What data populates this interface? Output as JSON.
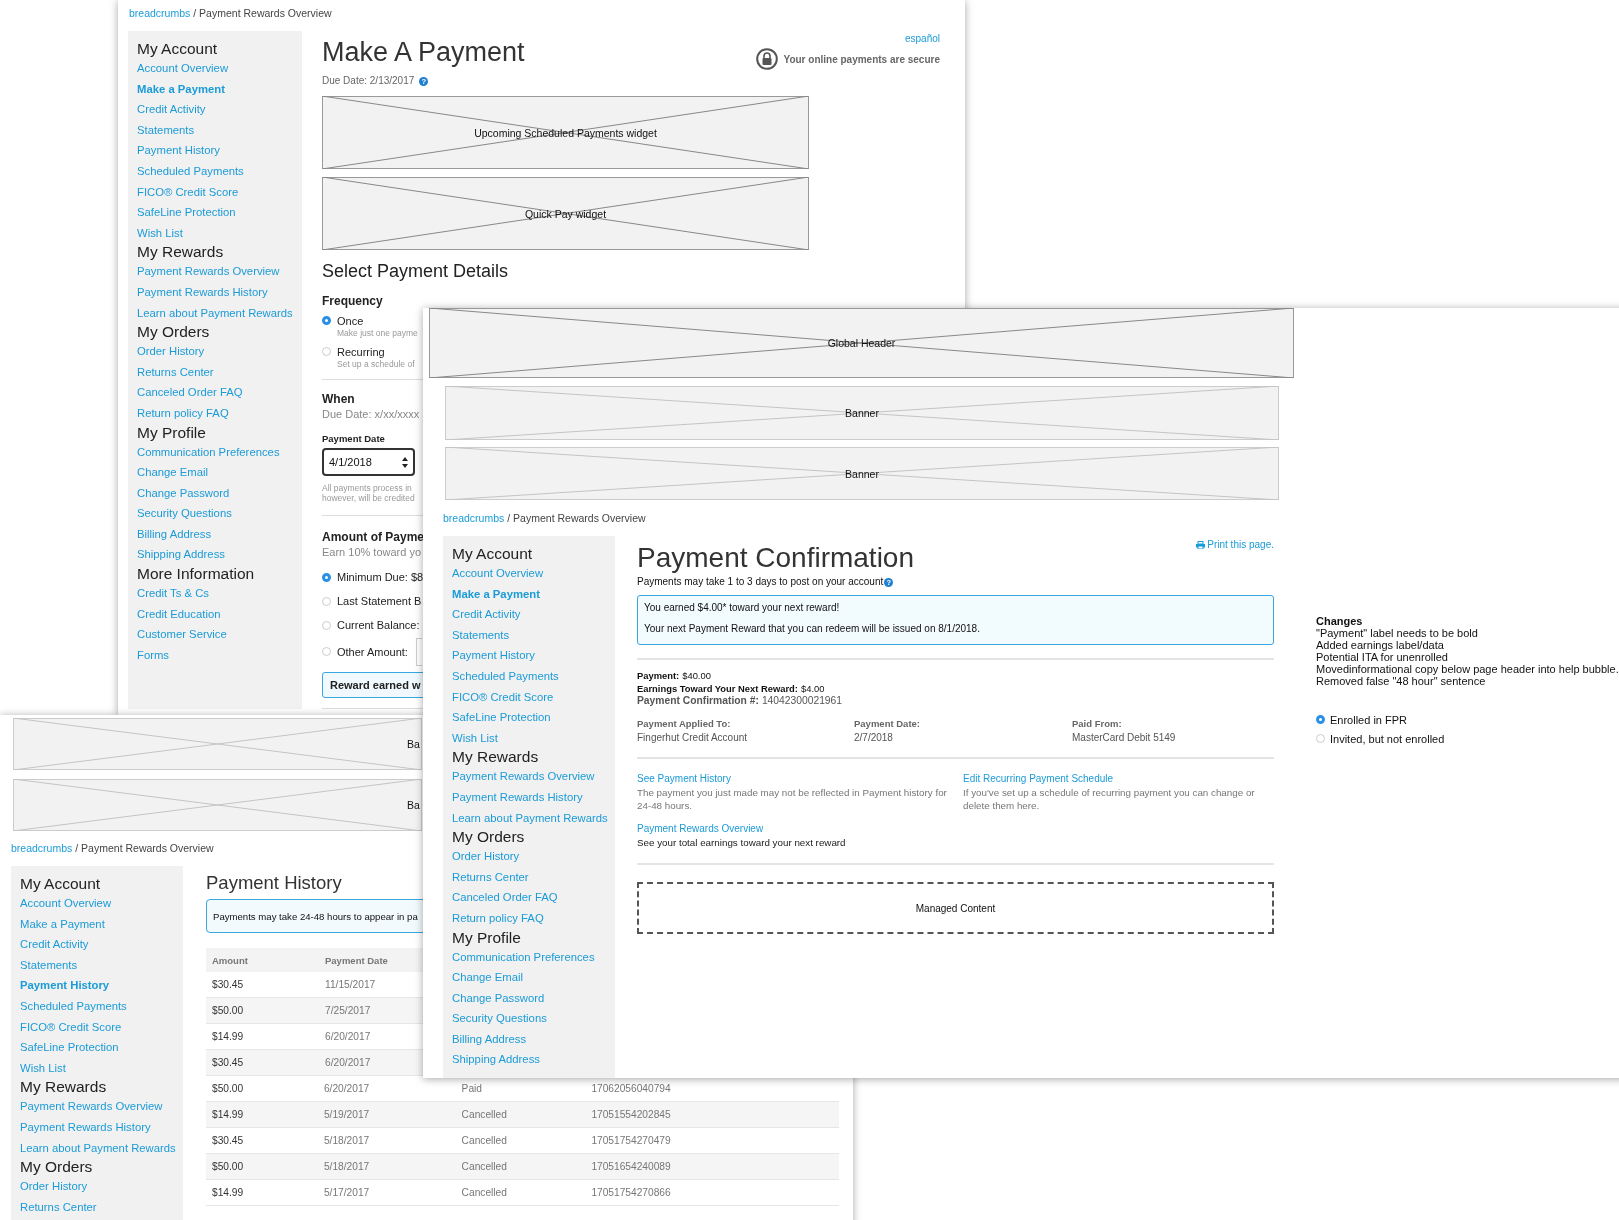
{
  "make_payment": {
    "breadcrumb_link": "breadcrumbs",
    "breadcrumb_rest": "/ Payment Rewards Overview",
    "sidebar": [
      {
        "heading": "My Account",
        "items": [
          {
            "label": "Account Overview",
            "selected": false
          },
          {
            "label": "Make a Payment",
            "selected": true
          },
          {
            "label": "Credit Activity",
            "selected": false
          },
          {
            "label": "Statements",
            "selected": false
          },
          {
            "label": "Payment History",
            "selected": false
          },
          {
            "label": "Scheduled Payments",
            "selected": false
          },
          {
            "label": "FICO® Credit Score",
            "selected": false
          },
          {
            "label": "SafeLine Protection",
            "selected": false
          },
          {
            "label": "Wish List",
            "selected": false
          }
        ]
      },
      {
        "heading": "My Rewards",
        "items": [
          {
            "label": "Payment Rewards Overview",
            "selected": false
          },
          {
            "label": "Payment Rewards History",
            "selected": false
          },
          {
            "label": "Learn about Payment Rewards",
            "selected": false
          }
        ]
      },
      {
        "heading": "My Orders",
        "items": [
          {
            "label": "Order History",
            "selected": false
          },
          {
            "label": "Returns Center",
            "selected": false
          },
          {
            "label": "Canceled Order FAQ",
            "selected": false
          },
          {
            "label": "Return policy FAQ",
            "selected": false
          }
        ]
      },
      {
        "heading": "My Profile",
        "items": [
          {
            "label": "Communication Preferences",
            "selected": false
          },
          {
            "label": "Change Email",
            "selected": false
          },
          {
            "label": "Change Password",
            "selected": false
          },
          {
            "label": "Security Questions",
            "selected": false
          },
          {
            "label": "Billing Address",
            "selected": false
          },
          {
            "label": "Shipping Address",
            "selected": false
          }
        ]
      },
      {
        "heading": "More Information",
        "items": [
          {
            "label": "Credit Ts & Cs",
            "selected": false
          },
          {
            "label": "Credit Education",
            "selected": false
          },
          {
            "label": "Customer Service",
            "selected": false
          },
          {
            "label": "Forms",
            "selected": false
          }
        ]
      }
    ],
    "title": "Make A Payment",
    "due_date": "Due Date: 2/13/2017",
    "help_icon": "?",
    "language_link": "español",
    "secure_note": "Your online payments are secure",
    "widgets": [
      "Upcoming Scheduled Payments widget",
      "Quick Pay widget"
    ],
    "section_title": "Select Payment Details",
    "frequency_label": "Frequency",
    "frequency_options": [
      {
        "label": "Once",
        "hint": "Make just one payme",
        "selected": true
      },
      {
        "label": "Recurring",
        "hint": "Set up a schedule of",
        "selected": false
      }
    ],
    "when_label": "When",
    "when_due": "Due Date: x/xx/xxxx",
    "payment_date_label": "Payment Date",
    "payment_date_value": "4/1/2018",
    "payment_date_note": [
      "All payments process in",
      "however, will be credited"
    ],
    "amount_label": "Amount of Payme",
    "amount_hint": "Earn 10% toward yo",
    "amount_options": [
      {
        "label": "Minimum Due: $8",
        "selected": true,
        "kind": "plain"
      },
      {
        "label": "Last Statement B",
        "selected": false,
        "kind": "plain"
      },
      {
        "label": "Current Balance:",
        "selected": false,
        "kind": "plain"
      },
      {
        "label": "Other Amount:",
        "selected": false,
        "kind": "field"
      }
    ],
    "reward_note": "Reward earned w"
  },
  "payment_history": {
    "banners": [
      "Ba",
      "Ba"
    ],
    "breadcrumb_link": "breadcrumbs",
    "breadcrumb_rest": "/ Payment Rewards Overview",
    "sidebar": [
      {
        "heading": "My Account",
        "items": [
          {
            "label": "Account Overview",
            "selected": false
          },
          {
            "label": "Make a Payment",
            "selected": false
          },
          {
            "label": "Credit Activity",
            "selected": false
          },
          {
            "label": "Statements",
            "selected": false
          },
          {
            "label": "Payment History",
            "selected": true
          },
          {
            "label": "Scheduled Payments",
            "selected": false
          },
          {
            "label": "FICO® Credit Score",
            "selected": false
          },
          {
            "label": "SafeLine Protection",
            "selected": false
          },
          {
            "label": "Wish List",
            "selected": false
          }
        ]
      },
      {
        "heading": "My Rewards",
        "items": [
          {
            "label": "Payment Rewards Overview",
            "selected": false
          },
          {
            "label": "Payment Rewards History",
            "selected": false
          },
          {
            "label": "Learn about Payment Rewards",
            "selected": false
          }
        ]
      },
      {
        "heading": "My Orders",
        "items": [
          {
            "label": "Order History",
            "selected": false
          },
          {
            "label": "Returns Center",
            "selected": false
          }
        ]
      }
    ],
    "title": "Payment History",
    "notice": "Payments may take 24-48 hours to appear in pa",
    "columns": [
      "Amount",
      "Payment Date"
    ],
    "rows": [
      {
        "cells": [
          "$30.45",
          "11/15/2017"
        ]
      },
      {
        "cells": [
          "$50.00",
          "7/25/2017"
        ]
      },
      {
        "cells": [
          "$14.99",
          "6/20/2017"
        ]
      },
      {
        "cells": [
          "$30.45",
          "6/20/2017"
        ]
      },
      {
        "cells": [
          "$50.00",
          "6/20/2017",
          "Paid",
          "17062056040794"
        ]
      },
      {
        "cells": [
          "$14.99",
          "5/19/2017",
          "Cancelled",
          "17051554202845"
        ]
      },
      {
        "cells": [
          "$30.45",
          "5/18/2017",
          "Cancelled",
          "17051754270479"
        ]
      },
      {
        "cells": [
          "$50.00",
          "5/18/2017",
          "Cancelled",
          "17051654240089"
        ]
      },
      {
        "cells": [
          "$14.99",
          "5/17/2017",
          "Cancelled",
          "17051754270866"
        ]
      }
    ]
  },
  "payment_confirmation": {
    "header_placeholder": "Global Header",
    "banners": [
      "Banner",
      "Banner"
    ],
    "breadcrumb_link": "breadcrumbs",
    "breadcrumb_rest": "/ Payment Rewards Overview",
    "sidebar": [
      {
        "heading": "My Account",
        "items": [
          {
            "label": "Account Overview",
            "selected": false
          },
          {
            "label": "Make a Payment",
            "selected": true
          },
          {
            "label": "Credit Activity",
            "selected": false
          },
          {
            "label": "Statements",
            "selected": false
          },
          {
            "label": "Payment History",
            "selected": false
          },
          {
            "label": "Scheduled Payments",
            "selected": false
          },
          {
            "label": "FICO® Credit Score",
            "selected": false
          },
          {
            "label": "SafeLine Protection",
            "selected": false
          },
          {
            "label": "Wish List",
            "selected": false
          }
        ]
      },
      {
        "heading": "My Rewards",
        "items": [
          {
            "label": "Payment Rewards Overview",
            "selected": false
          },
          {
            "label": "Payment Rewards History",
            "selected": false
          },
          {
            "label": "Learn about Payment Rewards",
            "selected": false
          }
        ]
      },
      {
        "heading": "My Orders",
        "items": [
          {
            "label": "Order History",
            "selected": false
          },
          {
            "label": "Returns Center",
            "selected": false
          },
          {
            "label": "Canceled Order FAQ",
            "selected": false
          },
          {
            "label": "Return policy FAQ",
            "selected": false
          }
        ]
      },
      {
        "heading": "My Profile",
        "items": [
          {
            "label": "Communication Preferences",
            "selected": false
          },
          {
            "label": "Change Email",
            "selected": false
          },
          {
            "label": "Change Password",
            "selected": false
          },
          {
            "label": "Security Questions",
            "selected": false
          },
          {
            "label": "Billing Address",
            "selected": false
          },
          {
            "label": "Shipping Address",
            "selected": false
          }
        ]
      }
    ],
    "print_link": "Print this page.",
    "title": "Payment Confirmation",
    "subtitle": "Payments may take 1 to 3 days to post on your account",
    "help_icon": "?",
    "notice": [
      "You earned $4.00* toward your next reward!",
      "Your next Payment Reward that you can redeem will be issued on 8/1/2018."
    ],
    "summary": [
      {
        "label": "Payment:",
        "value": "$40.00",
        "kind": "strong"
      },
      {
        "label": "Earnings Toward Your Next Reward:",
        "value": "$4.00",
        "kind": "strong"
      },
      {
        "label": "Payment Confirmation #:",
        "value": "14042300021961",
        "kind": "muted"
      }
    ],
    "details": [
      {
        "label": "Payment Applied To:",
        "value": "Fingerhut Credit Account"
      },
      {
        "label": "Payment Date:",
        "value": "2/7/2018"
      },
      {
        "label": "Paid From:",
        "value": "MasterCard Debit 5149"
      }
    ],
    "actions": [
      {
        "link": "See Payment History",
        "text": "The payment you just made may not be reflected in Payment history for 24-48 hours."
      },
      {
        "link": "Edit Recurring Payment Schedule",
        "text": "If you've set up a schedule of recurring payment you can change or delete them here."
      },
      {
        "link": "Payment Rewards Overview",
        "text": "See your total earnings toward your next reward"
      }
    ],
    "managed_content": "Managed Content",
    "notes": {
      "title": "Changes",
      "lines": [
        "\"Payment\" label needs to be bold",
        "Added earnings label/data",
        "Potential ITA for unenrolled",
        "Movedinformational copy below page header into help bubble.",
        "Removed false \"48 hour\" sentence"
      ],
      "options": [
        {
          "label": "Enrolled in FPR",
          "selected": true
        },
        {
          "label": "Invited, but not enrolled",
          "selected": false
        }
      ]
    }
  }
}
